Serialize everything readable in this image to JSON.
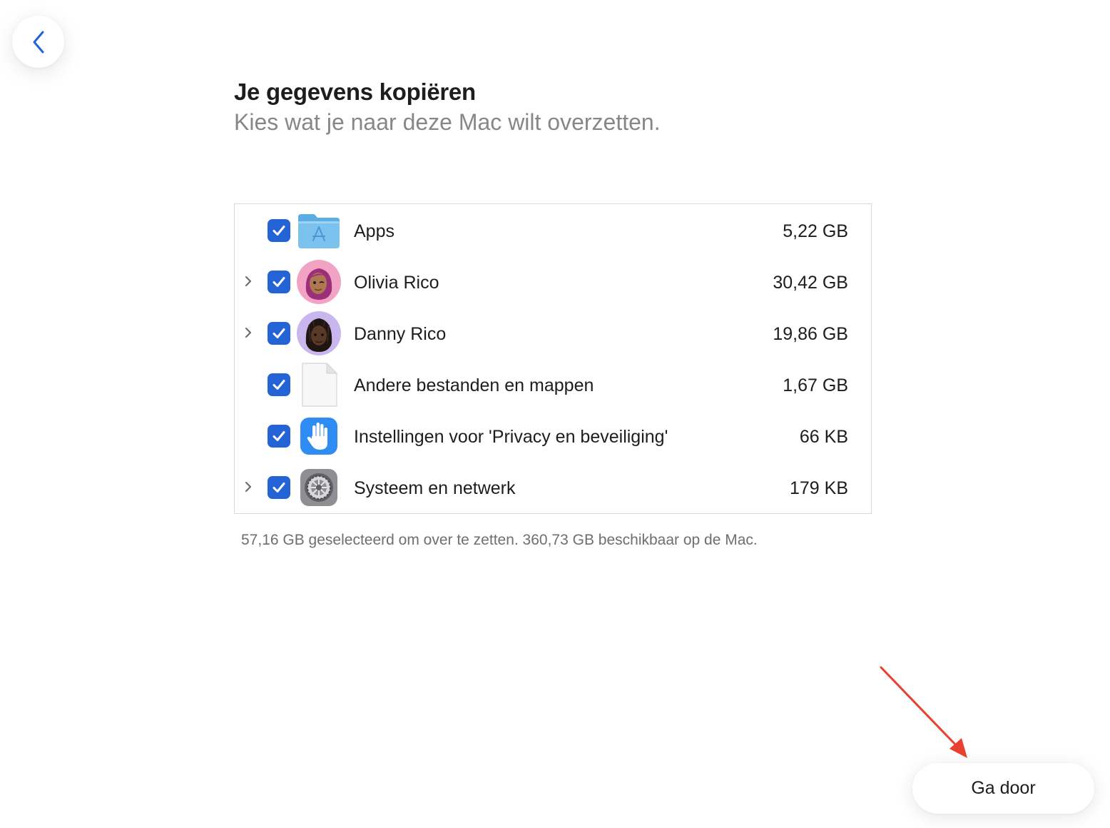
{
  "header": {
    "back_icon": "chevron-left-icon",
    "title": "Je gegevens kopiëren",
    "subtitle": "Kies wat je naar deze Mac wilt overzetten."
  },
  "items": [
    {
      "label": "Apps",
      "size": "5,22 GB",
      "checked": true,
      "expandable": false,
      "icon": "applications-folder-icon"
    },
    {
      "label": "Olivia Rico",
      "size": "30,42 GB",
      "checked": true,
      "expandable": true,
      "icon": "user-avatar-icon"
    },
    {
      "label": "Danny Rico",
      "size": "19,86 GB",
      "checked": true,
      "expandable": true,
      "icon": "user-avatar-icon"
    },
    {
      "label": "Andere bestanden en mappen",
      "size": "1,67 GB",
      "checked": true,
      "expandable": false,
      "icon": "document-icon"
    },
    {
      "label": "Instellingen voor 'Privacy en beveiliging'",
      "size": "66 KB",
      "checked": true,
      "expandable": false,
      "icon": "privacy-hand-icon"
    },
    {
      "label": "Systeem en netwerk",
      "size": "179 KB",
      "checked": true,
      "expandable": true,
      "icon": "system-settings-gear-icon"
    }
  ],
  "summary": "57,16 GB geselecteerd om over te zetten. 360,73 GB beschikbaar op de Mac.",
  "footer": {
    "continue_label": "Ga door"
  },
  "colors": {
    "checkbox_accent": "#2463d6",
    "annotation_arrow": "#e8412f",
    "back_chevron": "#2463d6"
  }
}
